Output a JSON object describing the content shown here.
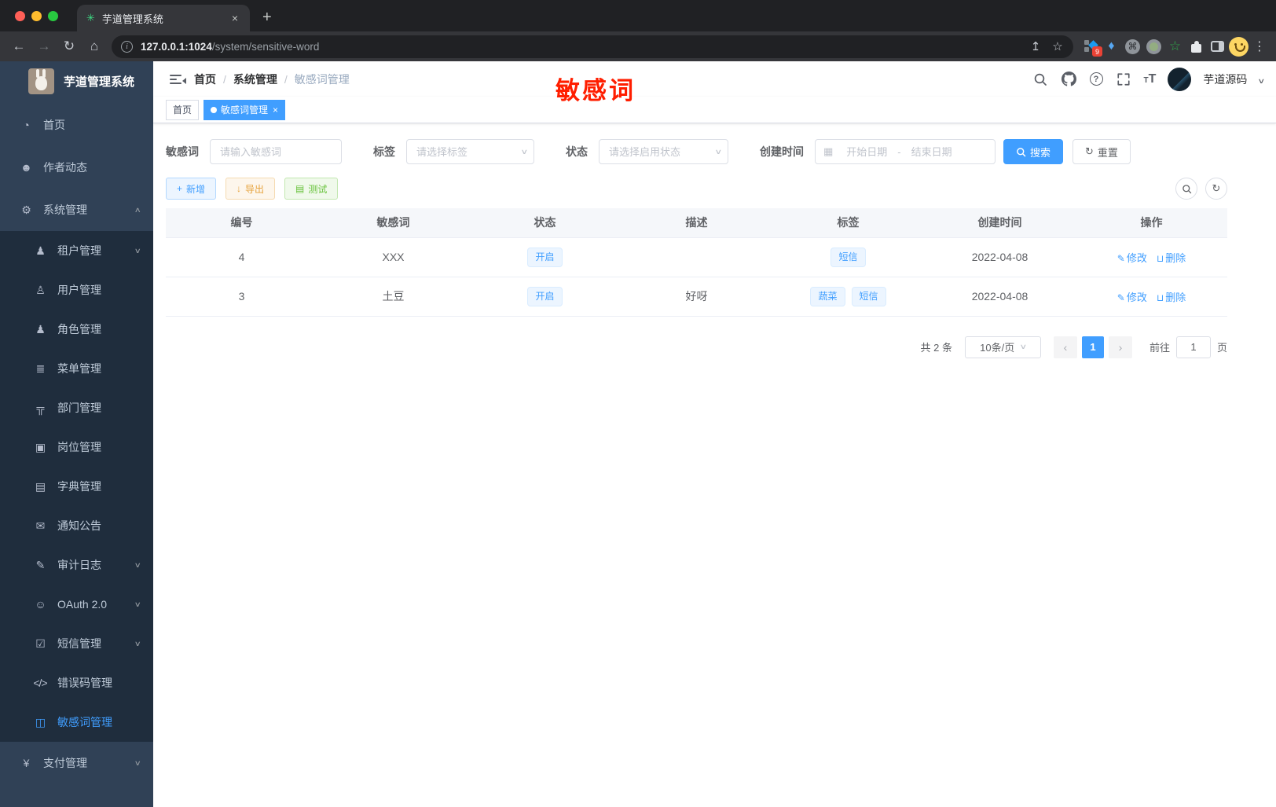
{
  "browser": {
    "tab_title": "芋道管理系统",
    "close_tab_glyph": "×",
    "new_tab_glyph": "+",
    "url_host": "127.0.0.1:1024",
    "url_path": "/system/sensitive-word",
    "extension_badge": "9"
  },
  "sidebar": {
    "logo_title": "芋道管理系统",
    "items": [
      {
        "icon": "dashboard-icon",
        "label": "首页",
        "type": "item"
      },
      {
        "icon": "author-icon",
        "label": "作者动态",
        "type": "item"
      },
      {
        "icon": "gear-icon",
        "label": "系统管理",
        "type": "item",
        "chevron": "up"
      },
      {
        "icon": "tenant-icon",
        "label": "租户管理",
        "type": "sub",
        "chevron": "down"
      },
      {
        "icon": "user-icon",
        "label": "用户管理",
        "type": "sub"
      },
      {
        "icon": "role-icon",
        "label": "角色管理",
        "type": "sub"
      },
      {
        "icon": "menu-tree-icon",
        "label": "菜单管理",
        "type": "sub"
      },
      {
        "icon": "dept-icon",
        "label": "部门管理",
        "type": "sub"
      },
      {
        "icon": "post-icon",
        "label": "岗位管理",
        "type": "sub"
      },
      {
        "icon": "dict-icon",
        "label": "字典管理",
        "type": "sub"
      },
      {
        "icon": "notice-icon",
        "label": "通知公告",
        "type": "sub"
      },
      {
        "icon": "audit-icon",
        "label": "审计日志",
        "type": "sub",
        "chevron": "down"
      },
      {
        "icon": "oauth-icon",
        "label": "OAuth 2.0",
        "type": "sub",
        "chevron": "down"
      },
      {
        "icon": "sms-icon",
        "label": "短信管理",
        "type": "sub",
        "chevron": "down"
      },
      {
        "icon": "errorcode-icon",
        "label": "错误码管理",
        "type": "sub"
      },
      {
        "icon": "sensitive-word-icon",
        "label": "敏感词管理",
        "type": "sub",
        "active": true
      },
      {
        "icon": "pay-icon",
        "label": "支付管理",
        "type": "item",
        "chevron": "down"
      }
    ]
  },
  "header": {
    "breadcrumb": [
      "首页",
      "系统管理",
      "敏感词管理"
    ],
    "breadcrumb_separator": "/",
    "annotation": "敏感词",
    "username": "芋道源码"
  },
  "tags_view": {
    "tabs": [
      {
        "label": "首页",
        "active": false,
        "closable": false
      },
      {
        "label": "敏感词管理",
        "active": true,
        "closable": true
      }
    ],
    "close_glyph": "×"
  },
  "filters": {
    "keyword": {
      "label": "敏感词",
      "placeholder": "请输入敏感词"
    },
    "tag": {
      "label": "标签",
      "placeholder": "请选择标签"
    },
    "status": {
      "label": "状态",
      "placeholder": "请选择启用状态"
    },
    "create_time": {
      "label": "创建时间",
      "start_placeholder": "开始日期",
      "separator": "-",
      "end_placeholder": "结束日期"
    },
    "search_label": "搜索",
    "reset_label": "重置"
  },
  "toolbar": {
    "add_label": "新增",
    "export_label": "导出",
    "test_label": "测试"
  },
  "table": {
    "columns": [
      "编号",
      "敏感词",
      "状态",
      "描述",
      "标签",
      "创建时间",
      "操作"
    ],
    "rows": [
      {
        "id": "4",
        "word": "XXX",
        "status": "开启",
        "description": "",
        "tags": [
          "短信"
        ],
        "create_time": "2022-04-08"
      },
      {
        "id": "3",
        "word": "土豆",
        "status": "开启",
        "description": "好呀",
        "tags": [
          "蔬菜",
          "短信"
        ],
        "create_time": "2022-04-08"
      }
    ],
    "edit_label": "修改",
    "delete_label": "删除"
  },
  "pagination": {
    "total_text": "共 2 条",
    "page_size": "10条/页",
    "prev_glyph": "‹",
    "current_page": "1",
    "next_glyph": "›",
    "goto_label": "前往",
    "goto_value": "1",
    "page_unit": "页"
  },
  "colors": {
    "accent": "#409eff",
    "annotation_red": "#ff1e00",
    "sidebar_bg": "#304156",
    "submenu_bg": "#1f2d3d",
    "sidebar_text": "#bfcbd9",
    "tag_bg": "#ecf5ff",
    "warning": "#e6a23c",
    "success": "#67c23a"
  }
}
